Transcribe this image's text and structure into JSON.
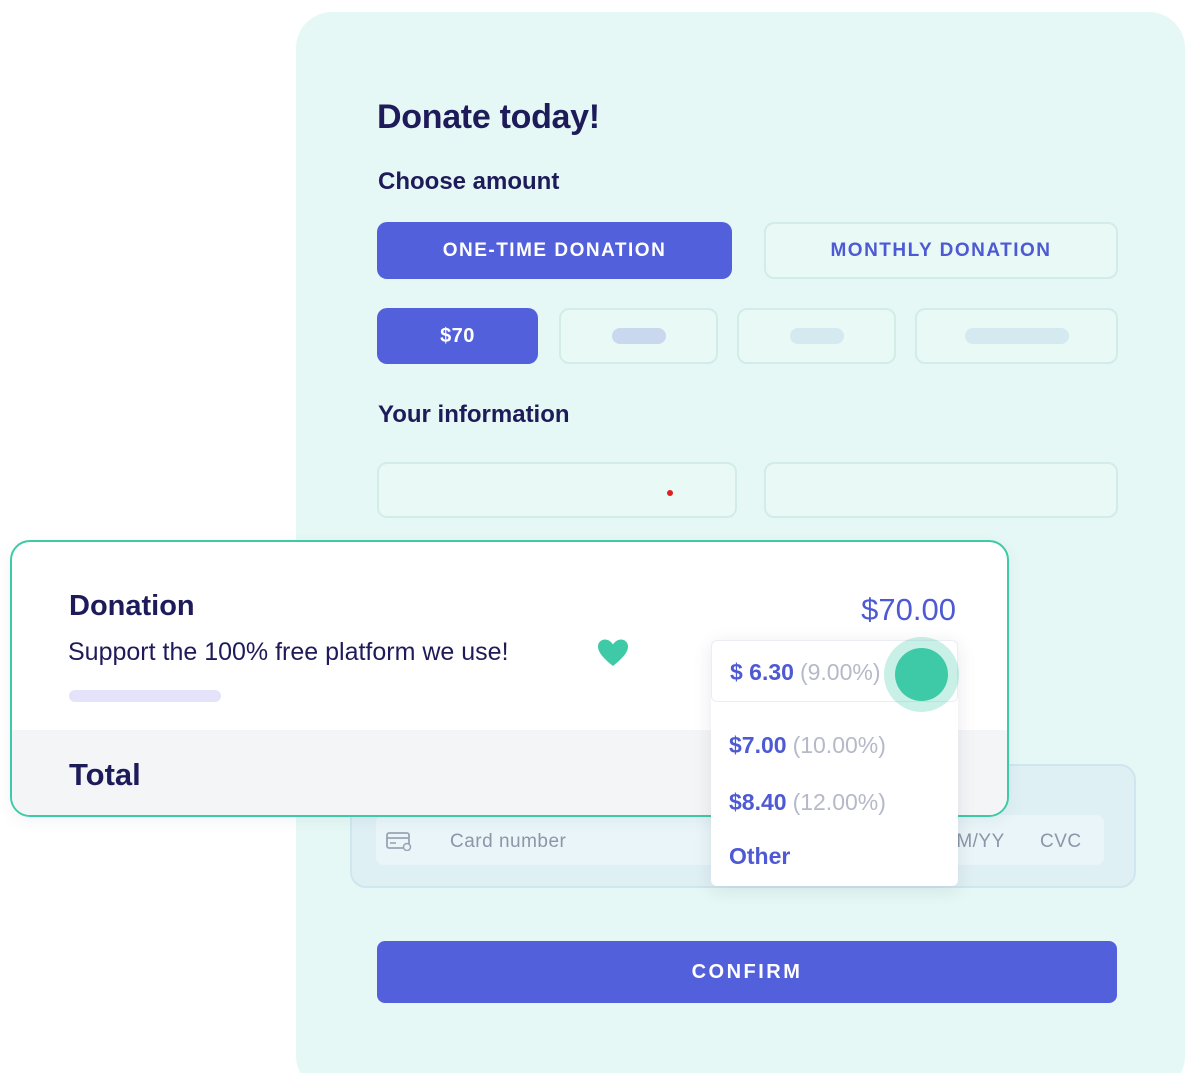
{
  "form": {
    "title": "Donate today!",
    "choose_amount_label": "Choose amount",
    "frequency_options": {
      "one_time": "ONE-TIME DONATION",
      "monthly": "MONTHLY DONATION",
      "selected": "one_time"
    },
    "amounts": {
      "selected_label": "$70"
    },
    "your_information_label": "Your information",
    "card": {
      "number_placeholder": "Card number",
      "expiry_placeholder": "MM/YY",
      "cvc_placeholder": "CVC"
    },
    "confirm_label": "CONFIRM"
  },
  "donation_panel": {
    "title": "Donation",
    "amount": "$70.00",
    "subtitle": "Support the 100% free platform we use!",
    "total_label": "Total"
  },
  "tip_dropdown": {
    "selected": {
      "amount": "$ 6.30",
      "percent": "(9.00%)"
    },
    "options": [
      {
        "amount": "$7.00",
        "percent": "(10.00%)"
      },
      {
        "amount": "$8.40",
        "percent": "(12.00%)"
      }
    ],
    "other_label": "Other"
  },
  "colors": {
    "primary": "#5260dc",
    "accent": "#3ec9a7",
    "card_bg": "#e6f8f5",
    "text": "#1e1b5a"
  },
  "icons": [
    "credit-card-icon",
    "heart-icon"
  ]
}
